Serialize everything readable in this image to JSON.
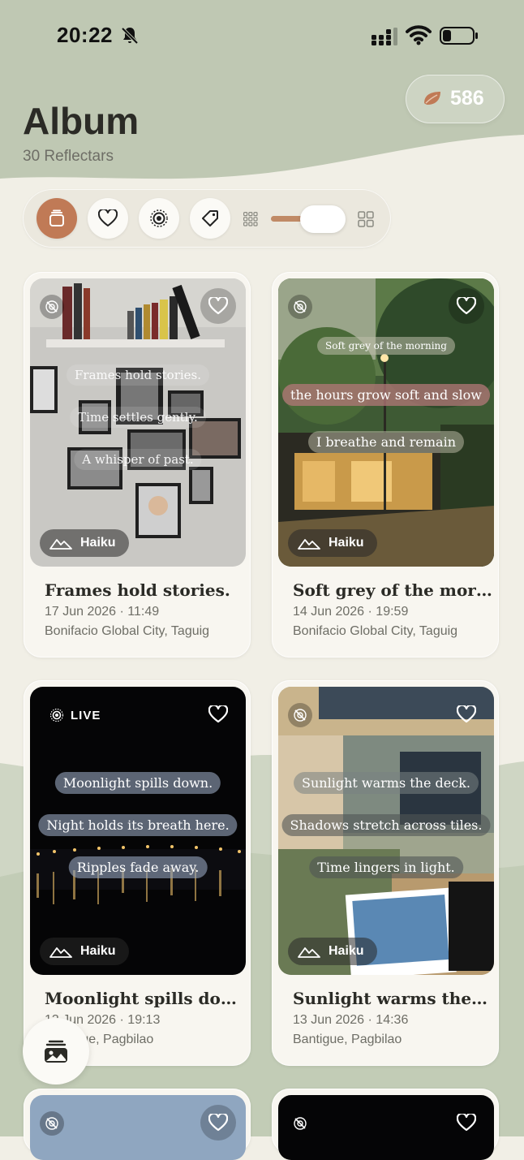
{
  "status": {
    "time": "20:22"
  },
  "header": {
    "title": "Album",
    "subtitle": "30 Reflectars",
    "points": "586"
  },
  "toolbar": {
    "buttons": [
      "all-items",
      "favorites",
      "live",
      "tags"
    ],
    "active": "all-items"
  },
  "cards": [
    {
      "title": "Frames hold stories.",
      "date": "17 Jun 2026 · 11:49",
      "location": "Bonifacio Global City, Taguig",
      "badge": "Haiku",
      "lines": [
        "Frames hold stories.",
        "Time settles gently.",
        "A whisper of past."
      ]
    },
    {
      "title": "Soft grey of the mor…",
      "date": "14 Jun 2026 · 19:59",
      "location": "Bonifacio Global City, Taguig",
      "badge": "Haiku",
      "lines": [
        "Soft grey of the morning",
        "the hours grow soft and slow",
        "I breathe and remain"
      ]
    },
    {
      "title": "Moonlight spills do…",
      "date": "13 Jun 2026 · 19:13",
      "location": "Bantigue, Pagbilao",
      "badge": "Haiku",
      "live": "LIVE",
      "lines": [
        "Moonlight spills down.",
        "Night holds its breath here.",
        "Ripples fade away."
      ]
    },
    {
      "title": "Sunlight warms the…",
      "date": "13 Jun 2026 · 14:36",
      "location": "Bantigue, Pagbilao",
      "badge": "Haiku",
      "lines": [
        "Sunlight warms the deck.",
        "Shadows stretch across tiles.",
        "Time lingers in light."
      ]
    }
  ],
  "colors": {
    "accent": "#c07a56",
    "sage": "#bfc8b3",
    "background": "#f1efe6"
  }
}
